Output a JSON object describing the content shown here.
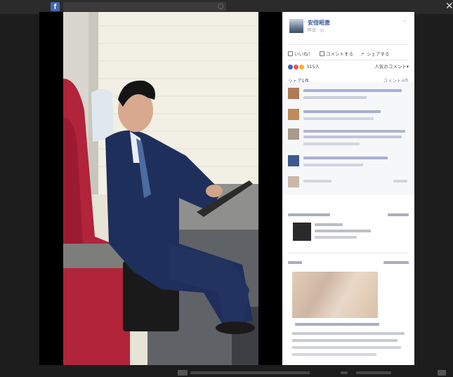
{
  "topbar": {
    "search_placeholder": "",
    "right_text": ""
  },
  "post": {
    "author": "安倍昭恵",
    "meta": "昨日 · ◎"
  },
  "actions": {
    "like": "いいね！",
    "comment": "コメントする",
    "share": "シェアする"
  },
  "reactions": {
    "count": "315人",
    "popular": "人気のコメント▾"
  },
  "stats": {
    "shares": "シェア1件",
    "comments": "コメント4件"
  },
  "colors": {
    "facebook_blue": "#4267b2",
    "link_blue": "#365899",
    "background": "#1d1d1d",
    "panel_bg": "#ffffff",
    "comment_bg": "#f6f7f9"
  }
}
